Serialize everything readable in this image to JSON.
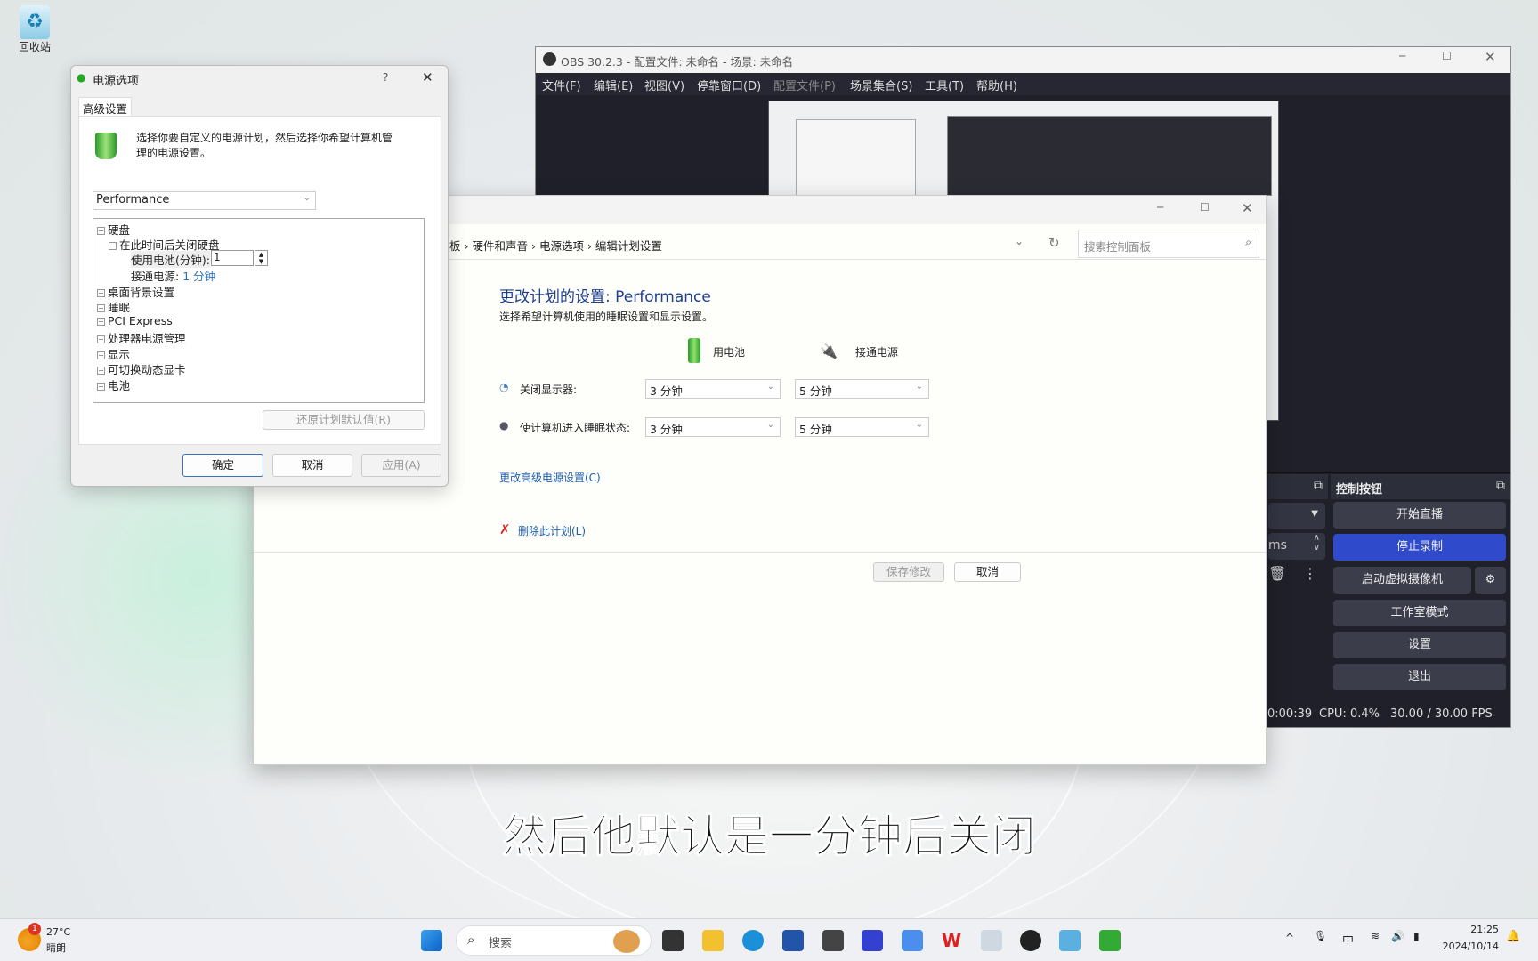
{
  "desktop": {
    "recycle_bin": "回收站"
  },
  "power_dialog": {
    "title": "电源选项",
    "help": "?",
    "tab": "高级设置",
    "description": "选择你要自定义的电源计划，然后选择你希望计算机管理的电源设置。",
    "plan": "Performance",
    "tree": [
      {
        "label": "硬盘",
        "sign": "−"
      },
      {
        "label": "在此时间后关闭硬盘",
        "sign": "−"
      },
      {
        "label": "使用电池(分钟):",
        "value": "1"
      },
      {
        "label": "接通电源:",
        "value": "1 分钟"
      },
      {
        "label": "桌面背景设置",
        "sign": "+"
      },
      {
        "label": "睡眠",
        "sign": "+"
      },
      {
        "label": "PCI Express",
        "sign": "+"
      },
      {
        "label": "处理器电源管理",
        "sign": "+"
      },
      {
        "label": "显示",
        "sign": "+"
      },
      {
        "label": "可切换动态显卡",
        "sign": "+"
      },
      {
        "label": "电池",
        "sign": "+"
      }
    ],
    "restore": "还原计划默认值(R)",
    "ok": "确定",
    "cancel": "取消",
    "apply": "应用(A)"
  },
  "obs": {
    "title": "OBS 30.2.3 - 配置文件: 未命名 - 场景: 未命名",
    "menu": [
      "文件(F)",
      "编辑(E)",
      "视图(V)",
      "停靠窗口(D)",
      "配置文件(P)",
      "场景集合(S)",
      "工具(T)",
      "帮助(H)"
    ],
    "controls_title": "控制按钮",
    "buttons": [
      "开始直播",
      "停止录制",
      "启动虚拟摄像机",
      "工作室模式",
      "设置",
      "退出"
    ],
    "partial_unit": "ms",
    "status": {
      "time": "0:00:39",
      "cpu": "CPU: 0.4%",
      "fps": "30.00 / 30.00 FPS"
    },
    "accent": "#2f4bcc"
  },
  "control_panel": {
    "breadcrumb": [
      "板",
      "硬件和声音",
      "电源选项",
      "编辑计划设置"
    ],
    "search_placeholder": "搜索控制面板",
    "heading": "更改计划的设置: Performance",
    "subheading": "选择希望计算机使用的睡眠设置和显示设置。",
    "col_battery": "用电池",
    "col_plugged": "接通电源",
    "rows": [
      {
        "label": "关闭显示器:",
        "battery": "3 分钟",
        "plugged": "5 分钟"
      },
      {
        "label": "使计算机进入睡眠状态:",
        "battery": "3 分钟",
        "plugged": "5 分钟"
      }
    ],
    "advanced_link": "更改高级电源设置(C)",
    "delete_link": "删除此计划(L)",
    "save": "保存修改",
    "cancel": "取消"
  },
  "subtitle": "然后他默认是一分钟后关闭",
  "taskbar": {
    "weather_temp": "27°C",
    "weather_desc": "晴朗",
    "weather_badge": "1",
    "search": "搜索",
    "time": "21:25",
    "date": "2024/10/14",
    "ime": "中"
  }
}
